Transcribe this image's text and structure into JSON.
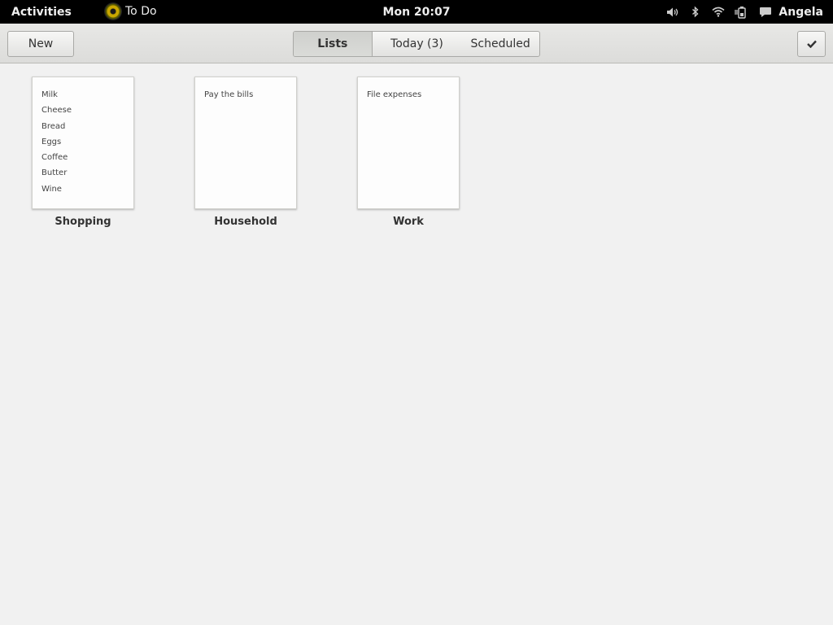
{
  "topbar": {
    "activities": "Activities",
    "app_name": "To Do",
    "clock": "Mon 20:07",
    "user": "Angela"
  },
  "header": {
    "new_label": "New",
    "tabs": [
      {
        "label": "Lists"
      },
      {
        "label": "Today (3)"
      },
      {
        "label": "Scheduled"
      }
    ],
    "active_tab": "Lists"
  },
  "lists": [
    {
      "title": "Shopping",
      "items": [
        "Milk",
        "Cheese",
        "Bread",
        "Eggs",
        "Coffee",
        "Butter",
        "Wine"
      ]
    },
    {
      "title": "Household",
      "items": [
        "Pay the bills"
      ]
    },
    {
      "title": "Work",
      "items": [
        "File expenses"
      ]
    }
  ]
}
